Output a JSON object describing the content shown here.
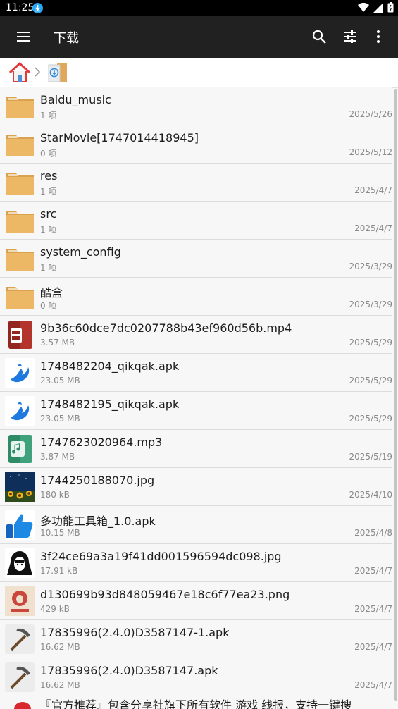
{
  "status": {
    "time": "11:25"
  },
  "appbar": {
    "title": "下载"
  },
  "files": [
    {
      "name": "Baidu_music",
      "meta": "1 项",
      "date": "2025/5/26",
      "icon": "folder"
    },
    {
      "name": "StarMovie[1747014418945]",
      "meta": "0 项",
      "date": "2025/5/12",
      "icon": "folder"
    },
    {
      "name": "res",
      "meta": "1 项",
      "date": "2025/4/7",
      "icon": "folder"
    },
    {
      "name": "src",
      "meta": "1 项",
      "date": "2025/4/7",
      "icon": "folder"
    },
    {
      "name": "system_config",
      "meta": "1 项",
      "date": "2025/3/29",
      "icon": "folder"
    },
    {
      "name": "酷盒",
      "meta": "0 项",
      "date": "2025/3/29",
      "icon": "folder"
    },
    {
      "name": "9b36c60dce7dc0207788b43ef960d56b.mp4",
      "meta": "3.57 MB",
      "date": "2025/5/29",
      "icon": "video"
    },
    {
      "name": "1748482204_qikqak.apk",
      "meta": "23.05 MB",
      "date": "2025/5/29",
      "icon": "bird-apk"
    },
    {
      "name": "1748482195_qikqak.apk",
      "meta": "23.05 MB",
      "date": "2025/5/29",
      "icon": "bird-apk"
    },
    {
      "name": "1747623020964.mp3",
      "meta": "3.87 MB",
      "date": "2025/5/19",
      "icon": "audio"
    },
    {
      "name": "1744250188070.jpg",
      "meta": "180 kB",
      "date": "2025/4/10",
      "icon": "sunflower-photo"
    },
    {
      "name": "多功能工具箱_1.0.apk",
      "meta": "10.15 MB",
      "date": "2025/4/8",
      "icon": "thumbs-up-apk"
    },
    {
      "name": "3f24ce69a3a19f41dd001596594dc098.jpg",
      "meta": "17.91 kB",
      "date": "2025/4/7",
      "icon": "portrait-photo"
    },
    {
      "name": "d130699b93d848059467e18c6f77ea23.png",
      "meta": "429 kB",
      "date": "2025/4/7",
      "icon": "poster-image"
    },
    {
      "name": "17835996(2.4.0)D3587147-1.apk",
      "meta": "16.62 MB",
      "date": "2025/4/7",
      "icon": "pickaxe-apk"
    },
    {
      "name": "17835996(2.4.0)D3587147.apk",
      "meta": "16.62 MB",
      "date": "2025/4/7",
      "icon": "pickaxe-apk"
    }
  ],
  "partial_row": {
    "name": "『官方推荐』包含分享社旗下所有软件 游戏 线报，支持一键搜"
  }
}
